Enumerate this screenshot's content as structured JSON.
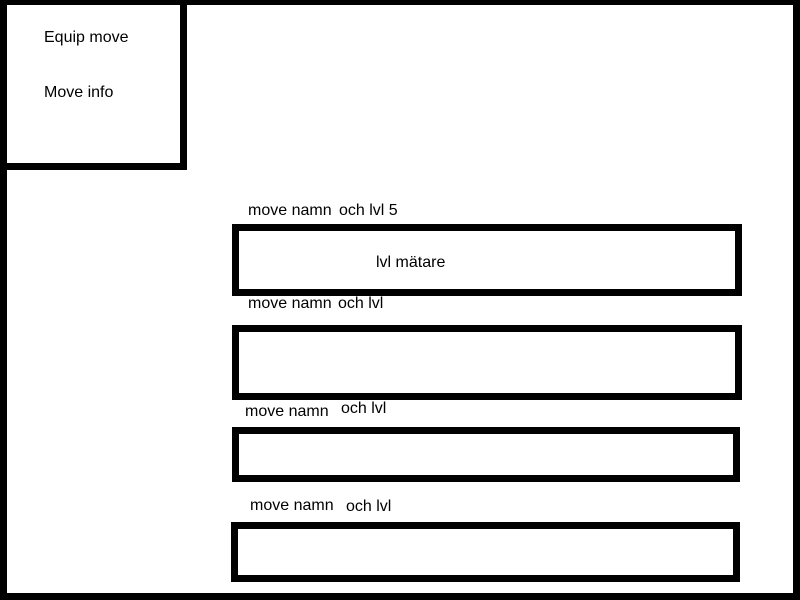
{
  "menu": {
    "items": [
      {
        "label": "Equip move"
      },
      {
        "label": "Move info"
      }
    ]
  },
  "moves": [
    {
      "name": "move namn",
      "level": "och lvl 5",
      "meter_label": "lvl mätare"
    },
    {
      "name": "move namn",
      "level": "och lvl"
    },
    {
      "name": "move namn",
      "level": "och lvl"
    },
    {
      "name": "move namn",
      "level": "och lvl"
    }
  ],
  "colors": {
    "border": "#000000",
    "background": "#ffffff",
    "text": "#000000"
  }
}
